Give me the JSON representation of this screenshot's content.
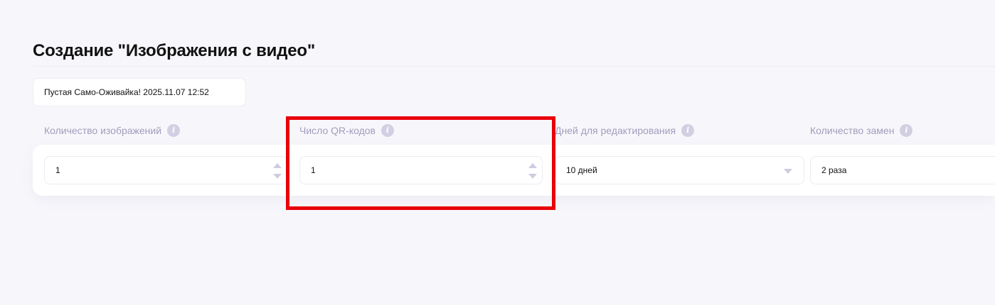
{
  "page": {
    "title": "Создание \"Изображения с видео\""
  },
  "name_field": {
    "value": "Пустая Само-Оживайка! 2025.11.07 12:52"
  },
  "fields": [
    {
      "label": "Количество изображений",
      "value": "1",
      "control": "number",
      "info_icon": "info-icon"
    },
    {
      "label": "Число QR-кодов",
      "value": "1",
      "control": "number",
      "info_icon": "info-icon"
    },
    {
      "label": "Дней для редактирования",
      "value": "10 дней",
      "control": "select",
      "info_icon": "info-icon"
    },
    {
      "label": "Количество замен",
      "value": "2 раза",
      "control": "text",
      "info_icon": "info-icon"
    }
  ],
  "info_icon_glyph": "i",
  "annotation": {
    "highlight_color": "#e8000a",
    "highlighted_field": "Число QR-кодов"
  },
  "colors": {
    "background": "#f7f7fb",
    "label": "#a39bbd",
    "control_arrow": "#cfcbe0"
  }
}
